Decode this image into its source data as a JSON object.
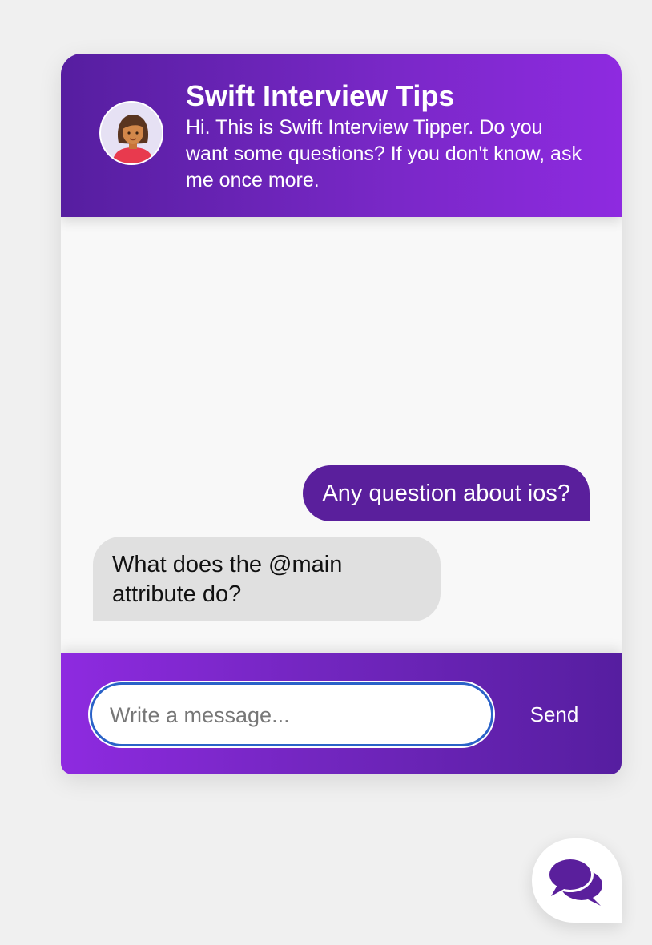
{
  "header": {
    "title": "Swift Interview Tips",
    "description": "Hi. This is Swift Interview Tipper. Do you want some questions? If you don't know, ask me once more.",
    "avatar_icon": "woman-avatar-icon"
  },
  "messages": [
    {
      "sender": "user",
      "text": "Any question about ios?"
    },
    {
      "sender": "bot",
      "text": "What does the @main attribute do?"
    }
  ],
  "composer": {
    "placeholder": "Write a message...",
    "value": "",
    "send_label": "Send"
  },
  "launcher": {
    "icon": "chat-bubbles-icon"
  },
  "colors": {
    "accent_dark": "#561ea0",
    "accent_light": "#8e2ae0",
    "user_bubble": "#5a1f9c",
    "bot_bubble": "#e0e0e0",
    "background": "#f0f0f0"
  }
}
